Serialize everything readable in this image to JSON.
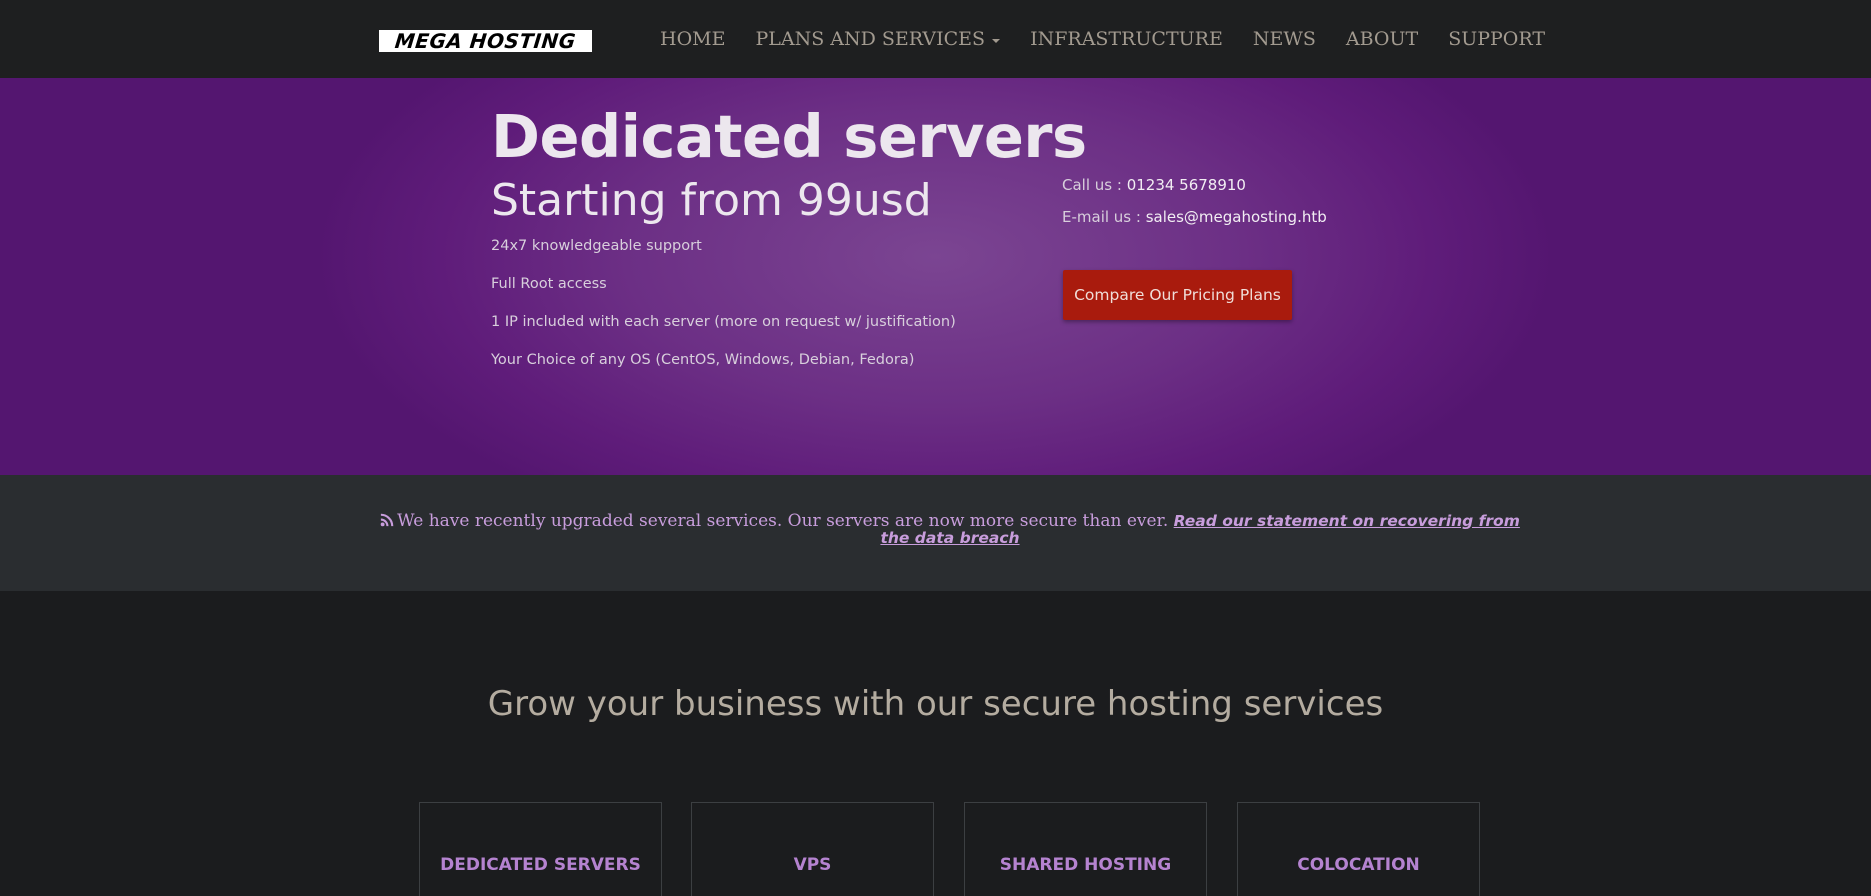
{
  "brand": {
    "logo_text": "MEGA HOSTING"
  },
  "nav": {
    "home": "HOME",
    "plans": "PLANS AND SERVICES",
    "infrastructure": "INFRASTRUCTURE",
    "news": "NEWS",
    "about": "ABOUT",
    "support": "SUPPORT"
  },
  "hero": {
    "title": "Dedicated servers",
    "subtitle": "Starting from 99usd",
    "features": [
      "24x7 knowledgeable support",
      "Full Root access",
      "1 IP included with each server (more on request w/ justification)",
      "Your Choice of any OS (CentOS, Windows, Debian, Fedora)"
    ],
    "call_label": "Call us : ",
    "call_value": "01234 5678910",
    "email_label": "E-mail us : ",
    "email_value": "sales@megahosting.htb",
    "cta_label": "Compare Our Pricing Plans"
  },
  "announcement": {
    "icon": "rss-icon",
    "text": "We have recently upgraded several services. Our servers are now more secure than ever. ",
    "link_text": "Read our statement on recovering from the data breach"
  },
  "services": {
    "heading": "Grow your business with our secure hosting services",
    "cards": [
      {
        "title": "DEDICATED SERVERS"
      },
      {
        "title": "VPS"
      },
      {
        "title": "SHARED HOSTING"
      },
      {
        "title": "COLOCATION"
      }
    ]
  },
  "colors": {
    "navbar_bg": "#1e1f20",
    "hero_purple": "#6c2f85",
    "cta_red": "#a91b0d",
    "announce_bg": "#2a2d30",
    "accent_lilac": "#c89ddc",
    "card_title": "#b583d0",
    "page_bg": "#1b1c1e"
  }
}
